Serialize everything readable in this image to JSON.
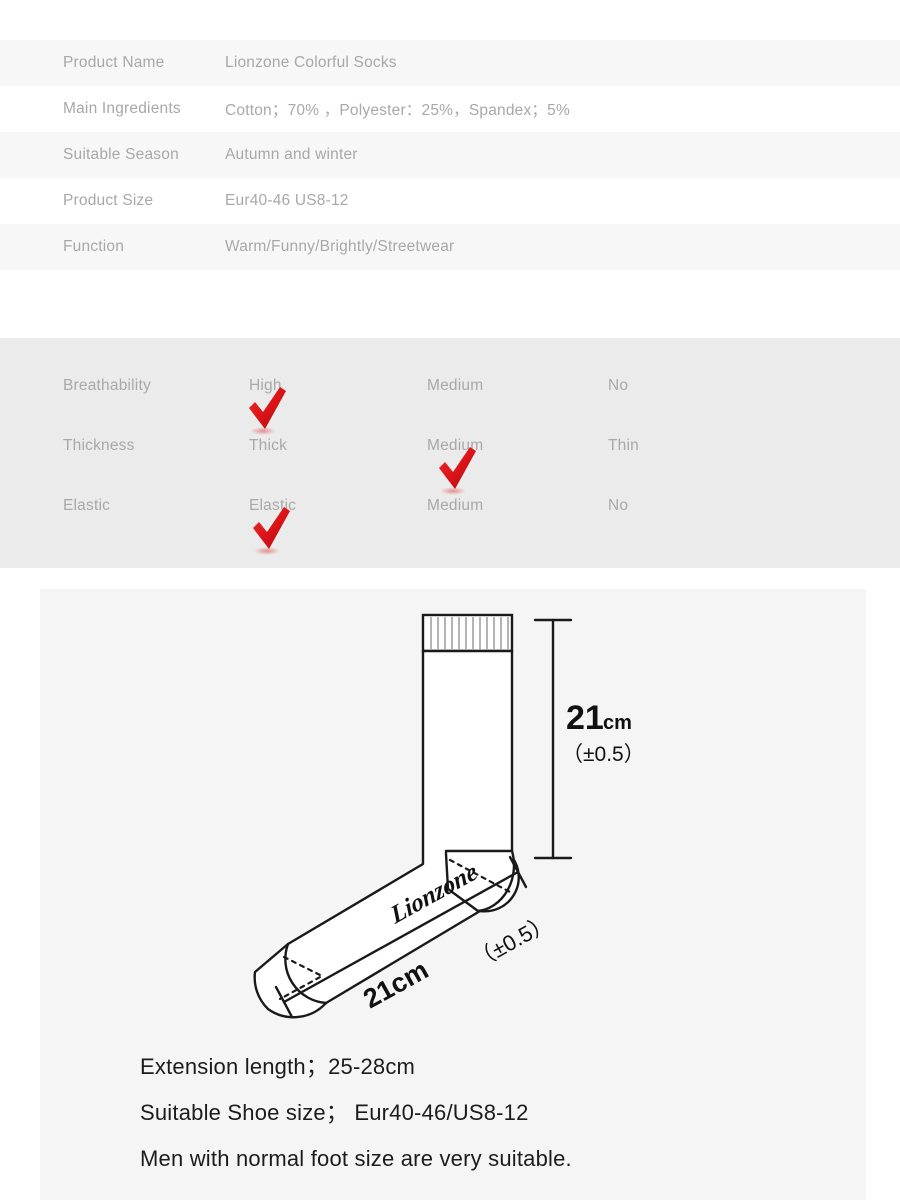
{
  "spec_table": {
    "rows": [
      {
        "label": "Product Name",
        "value": "Lionzone Colorful Socks"
      },
      {
        "label": "Main Ingredients",
        "value": "Cotton；70% ，Polyester：25%，Spandex；5%"
      },
      {
        "label": "Suitable Season",
        "value": "Autumn and winter"
      },
      {
        "label": "Product Size",
        "value": "Eur40-46 US8-12"
      },
      {
        "label": "Function",
        "value": "Warm/Funny/Brightly/Streetwear"
      }
    ]
  },
  "attributes": {
    "rows": [
      {
        "label": "Breathability",
        "options": [
          "High",
          "Medium",
          "No"
        ],
        "checked_index": 0
      },
      {
        "label": "Thickness",
        "options": [
          "Thick",
          "Medium",
          "Thin"
        ],
        "checked_index": 1
      },
      {
        "label": "Elastic",
        "options": [
          "Elastic",
          "Medium",
          "No"
        ],
        "checked_index": 0
      }
    ],
    "check_color": "#d81217"
  },
  "diagram": {
    "brand_script": "Lionzone",
    "height_value": "21",
    "height_unit": "cm",
    "height_tolerance": "（±0.5）",
    "foot_length": "21cm",
    "foot_tolerance": "（±0.5）",
    "notes": [
      "Extension length；25-28cm",
      "Suitable Shoe size；  Eur40-46/US8-12",
      "Men with normal foot size are very suitable."
    ]
  },
  "colors": {
    "panel_gray": "#ebebeb",
    "diagram_gray": "#f5f5f5",
    "row_stripe": "#f7f7f7",
    "muted_text": "#a8a8a8",
    "dark_text": "#1c1c1c",
    "line": "#1a1a1a"
  }
}
